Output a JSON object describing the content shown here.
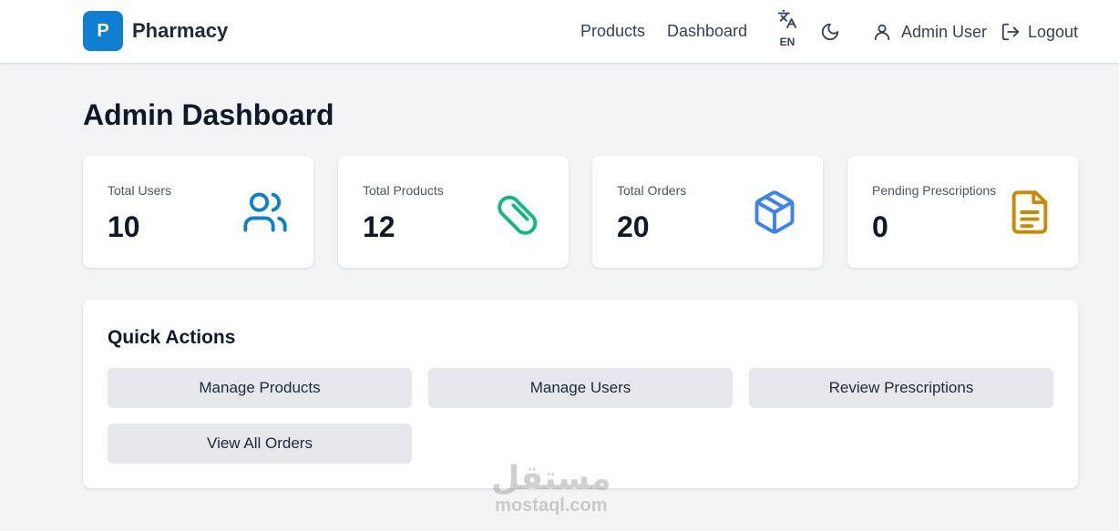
{
  "header": {
    "logo_letter": "P",
    "brand": "Pharmacy",
    "nav": {
      "products": "Products",
      "dashboard": "Dashboard"
    },
    "language": "EN",
    "user_name": "Admin User",
    "logout": "Logout"
  },
  "page": {
    "title": "Admin Dashboard"
  },
  "stats": [
    {
      "label": "Total Users",
      "value": "10",
      "icon": "users-icon",
      "color": "#0f7fd1"
    },
    {
      "label": "Total Products",
      "value": "12",
      "icon": "pill-icon",
      "color": "#10b981"
    },
    {
      "label": "Total Orders",
      "value": "20",
      "icon": "box-icon",
      "color": "#3b82f6"
    },
    {
      "label": "Pending Prescriptions",
      "value": "0",
      "icon": "document-icon",
      "color": "#ca8a04"
    }
  ],
  "quick_actions": {
    "title": "Quick Actions",
    "buttons": [
      "Manage Products",
      "Manage Users",
      "Review Prescriptions",
      "View All Orders"
    ]
  },
  "watermark": {
    "arabic": "مستقل",
    "latin": "mostaql.com"
  }
}
